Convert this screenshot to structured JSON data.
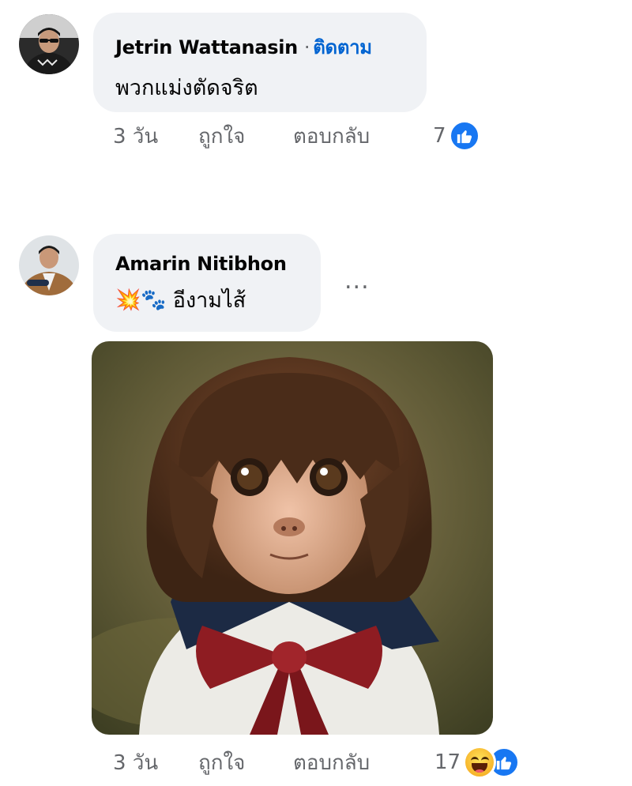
{
  "comments": [
    {
      "author": "Jetrin Wattanasin",
      "separator": "·",
      "follow_label": "ติดตาม",
      "text": "พวกแม่งตัดจริต",
      "timestamp": "3 วัน",
      "like_label": "ถูกใจ",
      "reply_label": "ตอบกลับ",
      "reaction_count": "7",
      "reaction_icons": [
        "like-icon"
      ]
    },
    {
      "author": "Amarin Nitibhon",
      "text_emojis": [
        "💥",
        "🐾"
      ],
      "text": "อีงามไส้",
      "more_label": "...",
      "timestamp": "3 วัน",
      "like_label": "ถูกใจ",
      "reply_label": "ตอบกลับ",
      "reaction_count": "17",
      "reaction_icons": [
        "haha-icon",
        "like-icon"
      ],
      "attachment": "monkey-with-bob-haircut-in-sailor-uniform-photo"
    }
  ],
  "colors": {
    "bubble": "#f0f2f5",
    "meta_text": "#65676b",
    "follow_link": "#0064d1",
    "like_blue": "#1877f2"
  }
}
